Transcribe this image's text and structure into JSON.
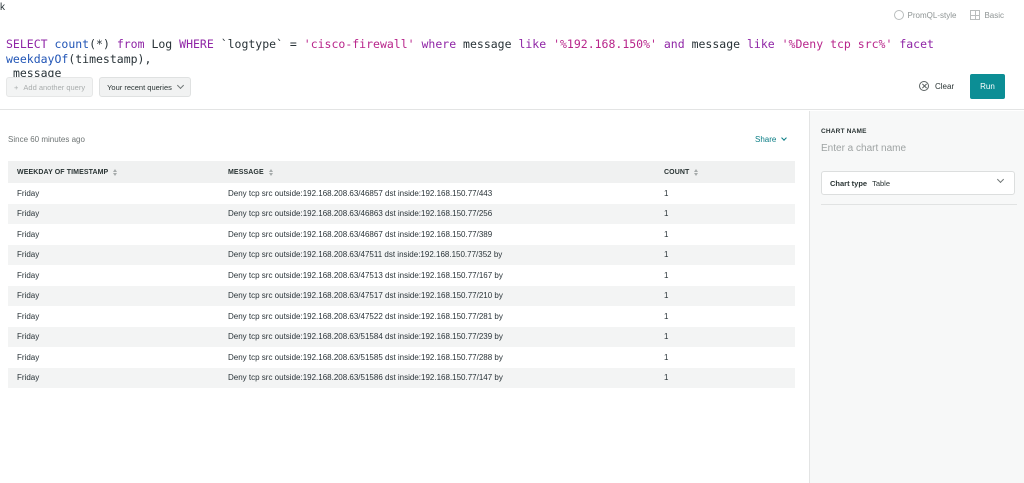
{
  "corner_mark": "k",
  "mode_switch": {
    "promql_label": "PromQL-style",
    "basic_label": "Basic"
  },
  "query": {
    "tokens": [
      {
        "t": "SELECT",
        "c": "kw"
      },
      {
        "t": " ",
        "c": ""
      },
      {
        "t": "count",
        "c": "fn"
      },
      {
        "t": "(*) ",
        "c": ""
      },
      {
        "t": "from",
        "c": "kw"
      },
      {
        "t": " Log ",
        "c": ""
      },
      {
        "t": "WHERE",
        "c": "kw"
      },
      {
        "t": " `logtype` = ",
        "c": ""
      },
      {
        "t": "'cisco-firewall'",
        "c": "str"
      },
      {
        "t": " ",
        "c": ""
      },
      {
        "t": "where",
        "c": "kw"
      },
      {
        "t": " message ",
        "c": ""
      },
      {
        "t": "like",
        "c": "kw"
      },
      {
        "t": " ",
        "c": ""
      },
      {
        "t": "'%192.168.150%'",
        "c": "str"
      },
      {
        "t": " ",
        "c": ""
      },
      {
        "t": "and",
        "c": "kw"
      },
      {
        "t": " message ",
        "c": ""
      },
      {
        "t": "like",
        "c": "kw"
      },
      {
        "t": " ",
        "c": ""
      },
      {
        "t": "'%Deny tcp src%'",
        "c": "str"
      },
      {
        "t": " ",
        "c": ""
      },
      {
        "t": "facet",
        "c": "kw"
      },
      {
        "t": " ",
        "c": ""
      },
      {
        "t": "weekdayOf",
        "c": "fn"
      },
      {
        "t": "(timestamp),\n message",
        "c": ""
      }
    ]
  },
  "toolbar": {
    "add_query_label": "Add another query",
    "recent_label": "Your recent queries",
    "clear_label": "Clear",
    "run_label": "Run"
  },
  "results": {
    "since_label": "Since 60 minutes ago",
    "share_label": "Share",
    "columns": [
      "WEEKDAY OF TIMESTAMP",
      "MESSAGE",
      "COUNT"
    ],
    "rows": [
      [
        "Friday",
        "Deny tcp src outside:192.168.208.63/46857 dst inside:192.168.150.77/443",
        "1"
      ],
      [
        "Friday",
        "Deny tcp src outside:192.168.208.63/46863 dst inside:192.168.150.77/256",
        "1"
      ],
      [
        "Friday",
        "Deny tcp src outside:192.168.208.63/46867 dst inside:192.168.150.77/389",
        "1"
      ],
      [
        "Friday",
        "Deny tcp src outside:192.168.208.63/47511 dst inside:192.168.150.77/352 by",
        "1"
      ],
      [
        "Friday",
        "Deny tcp src outside:192.168.208.63/47513 dst inside:192.168.150.77/167 by",
        "1"
      ],
      [
        "Friday",
        "Deny tcp src outside:192.168.208.63/47517 dst inside:192.168.150.77/210 by",
        "1"
      ],
      [
        "Friday",
        "Deny tcp src outside:192.168.208.63/47522 dst inside:192.168.150.77/281 by",
        "1"
      ],
      [
        "Friday",
        "Deny tcp src outside:192.168.208.63/51584 dst inside:192.168.150.77/239 by",
        "1"
      ],
      [
        "Friday",
        "Deny tcp src outside:192.168.208.63/51585 dst inside:192.168.150.77/288 by",
        "1"
      ],
      [
        "Friday",
        "Deny tcp src outside:192.168.208.63/51586 dst inside:192.168.150.77/147 by",
        "1"
      ]
    ]
  },
  "settings": {
    "chart_name_label": "CHART NAME",
    "chart_name_placeholder": "Enter a chart name",
    "chart_type_label": "Chart type",
    "chart_type_value": "Table"
  },
  "colors": {
    "accent": "#0c8e95",
    "keyword": "#8f25a6",
    "function": "#2155b6",
    "string": "#b8258b"
  }
}
